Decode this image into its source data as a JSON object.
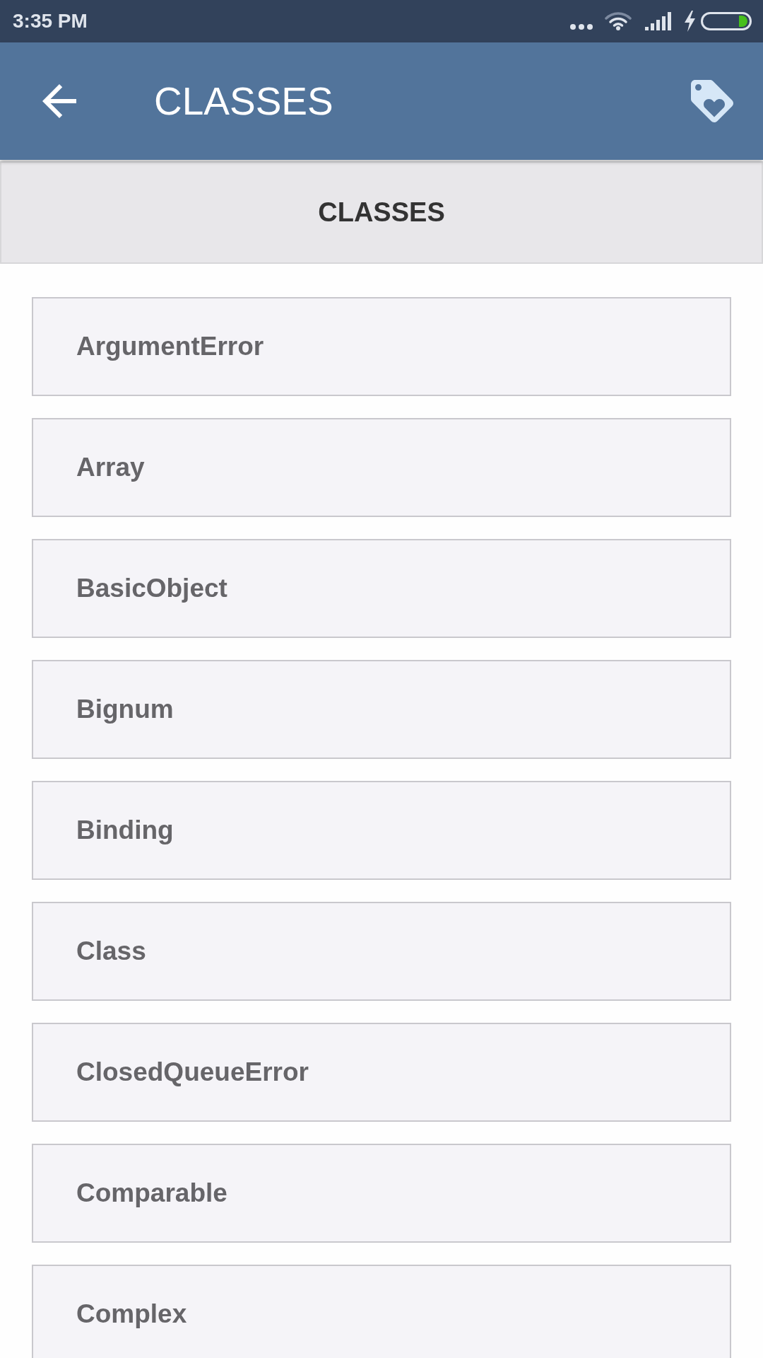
{
  "status_bar": {
    "time": "3:35 PM"
  },
  "app_bar": {
    "title": "CLASSES"
  },
  "section_header": {
    "title": "CLASSES"
  },
  "classes": [
    {
      "name": "ArgumentError"
    },
    {
      "name": "Array"
    },
    {
      "name": "BasicObject"
    },
    {
      "name": "Bignum"
    },
    {
      "name": "Binding"
    },
    {
      "name": "Class"
    },
    {
      "name": "ClosedQueueError"
    },
    {
      "name": "Comparable"
    },
    {
      "name": "Complex"
    }
  ]
}
